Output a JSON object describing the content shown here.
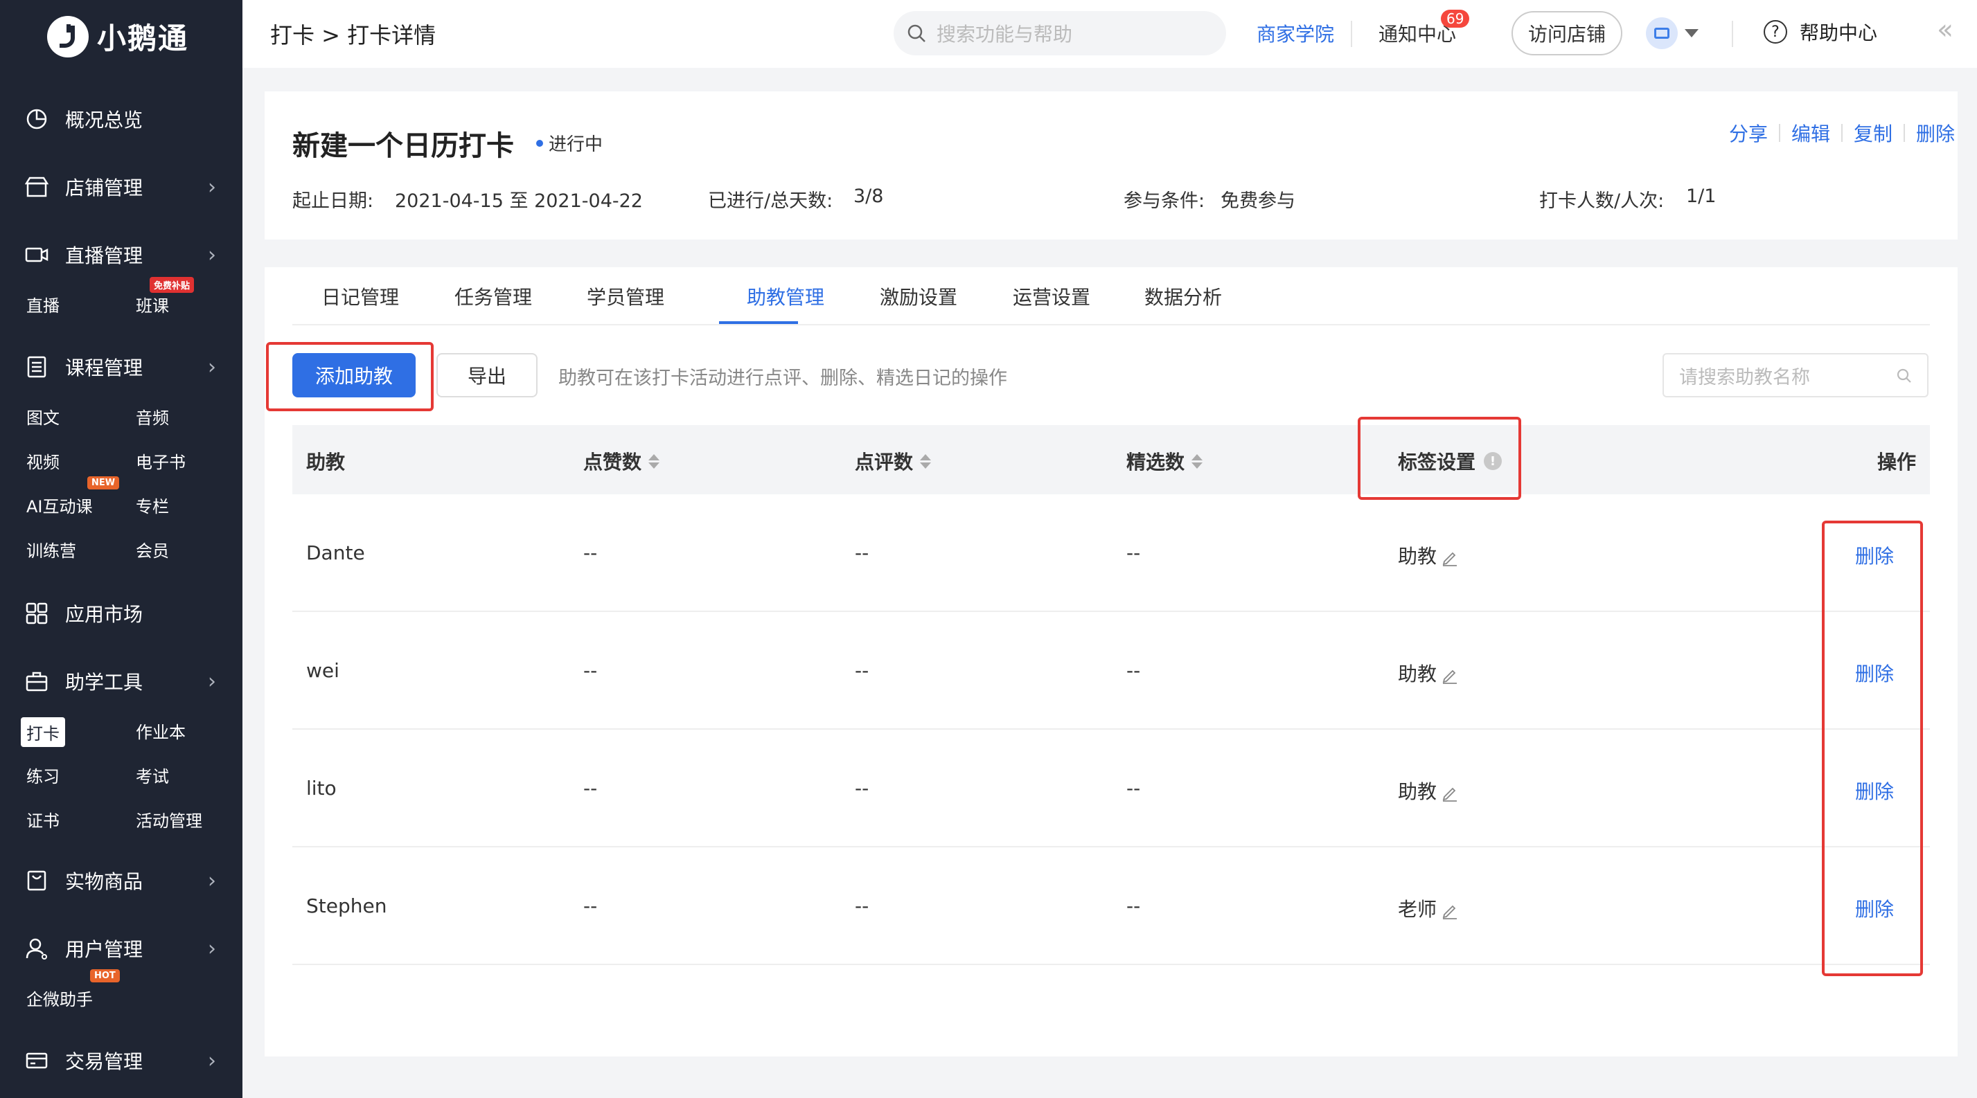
{
  "brand": {
    "name": "小鹅通"
  },
  "sidebar": {
    "overview": "概况总览",
    "shop": "店铺管理",
    "live": "直播管理",
    "live_subs": [
      "直播",
      "班课"
    ],
    "live_badge": "免费补贴",
    "course": "课程管理",
    "course_subs": [
      "图文",
      "音频",
      "视频",
      "电子书",
      "AI互动课",
      "专栏",
      "训练营",
      "会员"
    ],
    "course_badge": "NEW",
    "appmarket": "应用市场",
    "tools": "助学工具",
    "tools_subs": [
      "打卡",
      "作业本",
      "练习",
      "考试",
      "证书",
      "活动管理"
    ],
    "goods": "实物商品",
    "users": "用户管理",
    "users_subs": [
      "企微助手"
    ],
    "users_badge": "HOT",
    "trade": "交易管理"
  },
  "header": {
    "breadcrumb": "打卡 > 打卡详情",
    "search_placeholder": "搜索功能与帮助",
    "academy": "商家学院",
    "notice": "通知中心",
    "notice_count": "69",
    "visit": "访问店铺",
    "help": "帮助中心"
  },
  "checkin": {
    "title": "新建一个日历打卡",
    "status": "进行中",
    "actions": [
      "分享",
      "编辑",
      "复制",
      "删除"
    ],
    "date_label": "起止日期:",
    "date_value": "2021-04-15 至 2021-04-22",
    "progress_label": "已进行/总天数:",
    "progress_value": "3/8",
    "condition_label": "参与条件:",
    "condition_value": "免费参与",
    "count_label": "打卡人数/人次:",
    "count_value": "1/1"
  },
  "tabs": [
    "日记管理",
    "任务管理",
    "学员管理",
    "助教管理",
    "激励设置",
    "运营设置",
    "数据分析"
  ],
  "active_tab": "助教管理",
  "toolbar": {
    "add": "添加助教",
    "export": "导出",
    "tip": "助教可在该打卡活动进行点评、删除、精选日记的操作",
    "search_placeholder": "请搜索助教名称"
  },
  "table": {
    "headers": [
      "助教",
      "点赞数",
      "点评数",
      "精选数",
      "标签设置",
      "操作"
    ],
    "rows": [
      {
        "name": "Dante",
        "likes": "--",
        "comments": "--",
        "picks": "--",
        "tag": "助教",
        "op": "删除"
      },
      {
        "name": "wei",
        "likes": "--",
        "comments": "--",
        "picks": "--",
        "tag": "助教",
        "op": "删除"
      },
      {
        "name": "lito",
        "likes": "--",
        "comments": "--",
        "picks": "--",
        "tag": "助教",
        "op": "删除"
      },
      {
        "name": "Stephen",
        "likes": "--",
        "comments": "--",
        "picks": "--",
        "tag": "老师",
        "op": "删除"
      }
    ]
  },
  "colors": {
    "primary": "#2f6fe4",
    "sidebar": "#1f2533",
    "highlight": "#e53935"
  }
}
